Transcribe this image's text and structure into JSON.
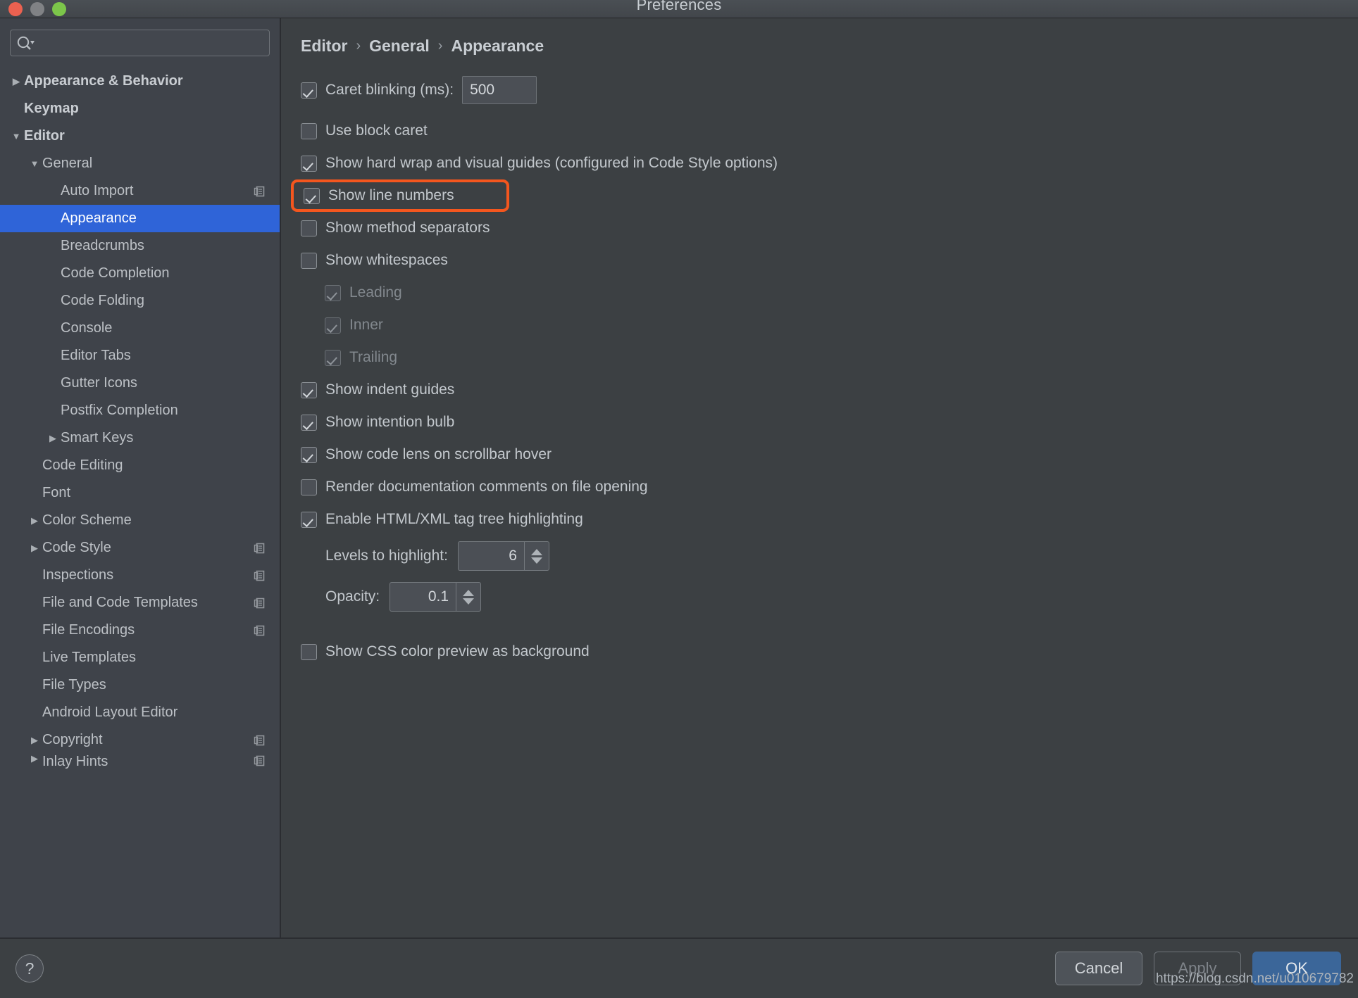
{
  "window": {
    "title": "Preferences",
    "controls": [
      "close-red",
      "minimize-gray",
      "maximize-green"
    ]
  },
  "search": {
    "value": "",
    "placeholder": "",
    "icon": "search-icon"
  },
  "sidebar": {
    "items": [
      {
        "label": "Appearance & Behavior",
        "arrow": "collapsed",
        "indent": 0,
        "bold": true,
        "selected": false,
        "copy": false
      },
      {
        "label": "Keymap",
        "arrow": "none",
        "indent": 0,
        "bold": true,
        "selected": false,
        "copy": false
      },
      {
        "label": "Editor",
        "arrow": "expanded",
        "indent": 0,
        "bold": true,
        "selected": false,
        "copy": false
      },
      {
        "label": "General",
        "arrow": "expanded",
        "indent": 1,
        "bold": false,
        "selected": false,
        "copy": false
      },
      {
        "label": "Auto Import",
        "arrow": "none",
        "indent": 2,
        "bold": false,
        "selected": false,
        "copy": true
      },
      {
        "label": "Appearance",
        "arrow": "none",
        "indent": 2,
        "bold": false,
        "selected": true,
        "copy": false
      },
      {
        "label": "Breadcrumbs",
        "arrow": "none",
        "indent": 2,
        "bold": false,
        "selected": false,
        "copy": false
      },
      {
        "label": "Code Completion",
        "arrow": "none",
        "indent": 2,
        "bold": false,
        "selected": false,
        "copy": false
      },
      {
        "label": "Code Folding",
        "arrow": "none",
        "indent": 2,
        "bold": false,
        "selected": false,
        "copy": false
      },
      {
        "label": "Console",
        "arrow": "none",
        "indent": 2,
        "bold": false,
        "selected": false,
        "copy": false
      },
      {
        "label": "Editor Tabs",
        "arrow": "none",
        "indent": 2,
        "bold": false,
        "selected": false,
        "copy": false
      },
      {
        "label": "Gutter Icons",
        "arrow": "none",
        "indent": 2,
        "bold": false,
        "selected": false,
        "copy": false
      },
      {
        "label": "Postfix Completion",
        "arrow": "none",
        "indent": 2,
        "bold": false,
        "selected": false,
        "copy": false
      },
      {
        "label": "Smart Keys",
        "arrow": "collapsed",
        "indent": 2,
        "bold": false,
        "selected": false,
        "copy": false
      },
      {
        "label": "Code Editing",
        "arrow": "none",
        "indent": 1,
        "bold": false,
        "selected": false,
        "copy": false
      },
      {
        "label": "Font",
        "arrow": "none",
        "indent": 1,
        "bold": false,
        "selected": false,
        "copy": false
      },
      {
        "label": "Color Scheme",
        "arrow": "collapsed",
        "indent": 1,
        "bold": false,
        "selected": false,
        "copy": false
      },
      {
        "label": "Code Style",
        "arrow": "collapsed",
        "indent": 1,
        "bold": false,
        "selected": false,
        "copy": true
      },
      {
        "label": "Inspections",
        "arrow": "none",
        "indent": 1,
        "bold": false,
        "selected": false,
        "copy": true
      },
      {
        "label": "File and Code Templates",
        "arrow": "none",
        "indent": 1,
        "bold": false,
        "selected": false,
        "copy": true
      },
      {
        "label": "File Encodings",
        "arrow": "none",
        "indent": 1,
        "bold": false,
        "selected": false,
        "copy": true
      },
      {
        "label": "Live Templates",
        "arrow": "none",
        "indent": 1,
        "bold": false,
        "selected": false,
        "copy": false
      },
      {
        "label": "File Types",
        "arrow": "none",
        "indent": 1,
        "bold": false,
        "selected": false,
        "copy": false
      },
      {
        "label": "Android Layout Editor",
        "arrow": "none",
        "indent": 1,
        "bold": false,
        "selected": false,
        "copy": false
      },
      {
        "label": "Copyright",
        "arrow": "collapsed",
        "indent": 1,
        "bold": false,
        "selected": false,
        "copy": true
      },
      {
        "label": "Inlay Hints",
        "arrow": "collapsed",
        "indent": 1,
        "bold": false,
        "selected": false,
        "copy": true
      }
    ]
  },
  "breadcrumb": {
    "parts": [
      "Editor",
      "General",
      "Appearance"
    ],
    "separator": "›"
  },
  "settings": {
    "caret_blinking": {
      "label": "Caret blinking (ms):",
      "checked": true,
      "value": "500"
    },
    "use_block_caret": {
      "label": "Use block caret",
      "checked": false
    },
    "show_hard_wrap": {
      "label": "Show hard wrap and visual guides (configured in Code Style options)",
      "checked": true
    },
    "show_line_numbers": {
      "label": "Show line numbers",
      "checked": true,
      "highlighted": true,
      "highlight_color": "#f4561e"
    },
    "show_method_separators": {
      "label": "Show method separators",
      "checked": false
    },
    "show_whitespaces": {
      "label": "Show whitespaces",
      "checked": false
    },
    "whitespace_leading": {
      "label": "Leading",
      "checked": true,
      "disabled": true
    },
    "whitespace_inner": {
      "label": "Inner",
      "checked": true,
      "disabled": true
    },
    "whitespace_trailing": {
      "label": "Trailing",
      "checked": true,
      "disabled": true
    },
    "show_indent_guides": {
      "label": "Show indent guides",
      "checked": true
    },
    "show_intention_bulb": {
      "label": "Show intention bulb",
      "checked": true
    },
    "show_code_lens": {
      "label": "Show code lens on scrollbar hover",
      "checked": true
    },
    "render_documentation": {
      "label": "Render documentation comments on file opening",
      "checked": false
    },
    "enable_tag_tree": {
      "label": "Enable HTML/XML tag tree highlighting",
      "checked": true
    },
    "levels_to_highlight": {
      "label": "Levels to highlight:",
      "value": "6"
    },
    "opacity": {
      "label": "Opacity:",
      "value": "0.1"
    },
    "show_css_preview": {
      "label": "Show CSS color preview as background",
      "checked": false
    }
  },
  "footer": {
    "help_label": "?",
    "cancel_label": "Cancel",
    "apply_label": "Apply",
    "ok_label": "OK",
    "ok_color": "#3b6699"
  },
  "watermark": {
    "text": "https://blog.csdn.net/u010679782"
  }
}
